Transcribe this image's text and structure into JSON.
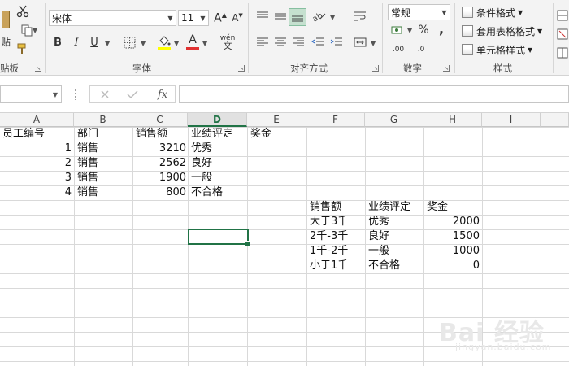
{
  "ribbon": {
    "clipboard": {
      "paste_label": "贴",
      "group_label": "贴板"
    },
    "font": {
      "font_name": "宋体",
      "font_size": "11",
      "bold": "B",
      "italic": "I",
      "underline": "U",
      "font_color_label": "A",
      "wen_top": "wén",
      "wen_bottom": "文",
      "group_label": "字体",
      "fill_color": "#ffff00",
      "font_color": "#e03131"
    },
    "alignment": {
      "group_label": "对齐方式"
    },
    "number": {
      "format": "常规",
      "percent": "%",
      "comma": ",",
      "inc_decimal": ".00",
      "dec_decimal": ".0",
      "group_label": "数字"
    },
    "styles": {
      "conditional": "条件格式",
      "table_format": "套用表格格式",
      "cell_styles": "单元格样式",
      "group_label": "样式"
    }
  },
  "formula_bar": {
    "fx": "fx",
    "value": ""
  },
  "columns": [
    "A",
    "B",
    "C",
    "D",
    "E",
    "F",
    "G",
    "H",
    "I"
  ],
  "selected_column": "D",
  "table1": {
    "headers": [
      "员工编号",
      "部门",
      "销售额",
      "业绩评定",
      "奖金"
    ],
    "rows": [
      {
        "id": "1",
        "dept": "销售",
        "sales": "3210",
        "rating": "优秀"
      },
      {
        "id": "2",
        "dept": "销售",
        "sales": "2562",
        "rating": "良好"
      },
      {
        "id": "3",
        "dept": "销售",
        "sales": "1900",
        "rating": "一般"
      },
      {
        "id": "4",
        "dept": "销售",
        "sales": "800",
        "rating": "不合格"
      }
    ]
  },
  "table2": {
    "headers": [
      "销售额",
      "业绩评定",
      "奖金"
    ],
    "rows": [
      {
        "range": "大于3千",
        "rating": "优秀",
        "bonus": "2000"
      },
      {
        "range": "2千-3千",
        "rating": "良好",
        "bonus": "1500"
      },
      {
        "range": "1千-2千",
        "rating": "一般",
        "bonus": "1000"
      },
      {
        "range": "小于1千",
        "rating": "不合格",
        "bonus": "0"
      }
    ]
  },
  "watermark": {
    "main": "Bai 经验",
    "sub": "jingyan.baidu.com"
  },
  "colors": {
    "accent": "#217346"
  }
}
